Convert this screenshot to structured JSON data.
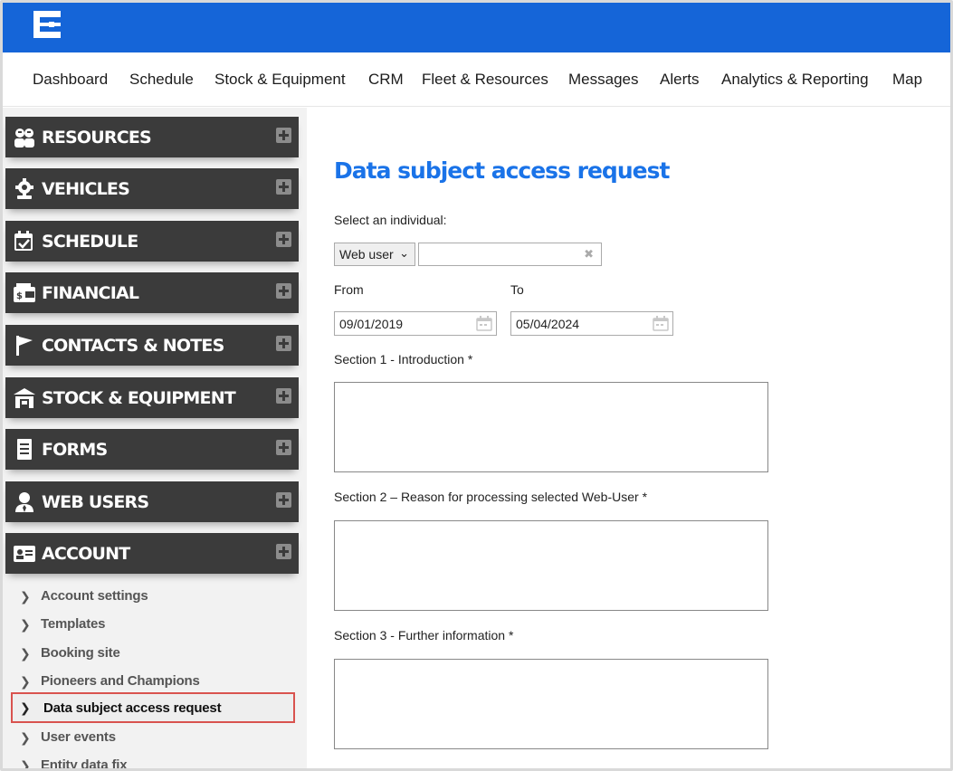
{
  "nav": {
    "items": [
      "Dashboard",
      "Schedule",
      "Stock & Equipment",
      "CRM",
      "Fleet & Resources",
      "Messages",
      "Alerts",
      "Analytics & Reporting",
      "Map"
    ]
  },
  "sidebar": {
    "sections": [
      {
        "label": "RESOURCES",
        "icon": "users-icon"
      },
      {
        "label": "VEHICLES",
        "icon": "gear-vehicle-icon"
      },
      {
        "label": "SCHEDULE",
        "icon": "calendar-check-icon"
      },
      {
        "label": "FINANCIAL",
        "icon": "wallet-icon"
      },
      {
        "label": "CONTACTS & NOTES",
        "icon": "flag-icon"
      },
      {
        "label": "STOCK & EQUIPMENT",
        "icon": "warehouse-icon"
      },
      {
        "label": "FORMS",
        "icon": "document-icon"
      },
      {
        "label": "WEB USERS",
        "icon": "user-tie-icon"
      },
      {
        "label": "ACCOUNT",
        "icon": "id-card-icon"
      }
    ],
    "account_items": [
      "Account settings",
      "Templates",
      "Booking site",
      "Pioneers and Champions",
      "Data subject access request",
      "User events",
      "Entity data fix"
    ],
    "active_item": "Data subject access request"
  },
  "form": {
    "title": "Data subject access request",
    "select_individual_label": "Select an individual:",
    "individual_type": "Web user",
    "individual_value": "",
    "from_label": "From",
    "from_value": "09/01/2019",
    "to_label": "To",
    "to_value": "05/04/2024",
    "section1_label": "Section 1 - Introduction *",
    "section2_label": "Section 2 – Reason for processing selected Web-User *",
    "section3_label": "Section 3 - Further information *"
  },
  "colors": {
    "brand_blue": "#1565d8",
    "title_blue": "#1a73e8",
    "sidebar_dark": "#3b3b3b",
    "active_border": "#d9534f"
  }
}
